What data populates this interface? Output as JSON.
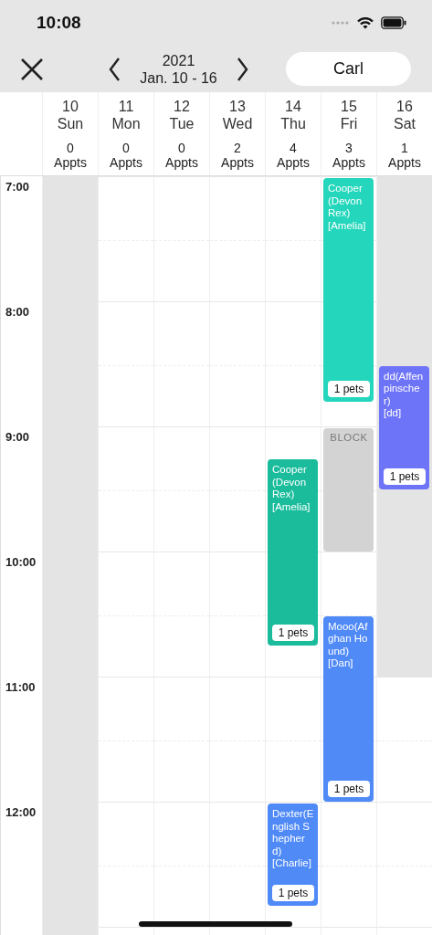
{
  "status_bar": {
    "time": "10:08"
  },
  "toolbar": {
    "year": "2021",
    "range": "Jan. 10 - 16",
    "staff": "Carl"
  },
  "hours": [
    "7:00",
    "8:00",
    "9:00",
    "10:00",
    "11:00",
    "12:00"
  ],
  "days": [
    {
      "date": "10",
      "weekday": "Sun",
      "count": "0",
      "count_label": "Appts",
      "unavailable": true
    },
    {
      "date": "11",
      "weekday": "Mon",
      "count": "0",
      "count_label": "Appts",
      "unavailable": false
    },
    {
      "date": "12",
      "weekday": "Tue",
      "count": "0",
      "count_label": "Appts",
      "unavailable": false
    },
    {
      "date": "13",
      "weekday": "Wed",
      "count": "2",
      "count_label": "Appts",
      "unavailable": false
    },
    {
      "date": "14",
      "weekday": "Thu",
      "count": "4",
      "count_label": "Appts",
      "unavailable": false,
      "events": [
        {
          "kind": "appointment",
          "title": "Cooper(Devon Rex)",
          "owner": "[Amelia]",
          "pets": "1 pets",
          "color": "#1abc9c"
        },
        {
          "kind": "appointment",
          "title": "Dexter(English Shepherd)",
          "owner": "[Charlie]",
          "pets": "1 pets",
          "color": "#4f8af7"
        }
      ]
    },
    {
      "date": "15",
      "weekday": "Fri",
      "count": "3",
      "count_label": "Appts",
      "unavailable": false,
      "events": [
        {
          "kind": "appointment",
          "title": "Cooper(Devon Rex)",
          "owner": "[Amelia]",
          "pets": "1 pets",
          "color": "#24d6bb"
        },
        {
          "kind": "block",
          "title": "BLOCK"
        },
        {
          "kind": "appointment",
          "title": "Mooo(Afghan Hound)",
          "owner": "[Dan]",
          "pets": "1 pets",
          "color": "#4f8af7"
        }
      ]
    },
    {
      "date": "16",
      "weekday": "Sat",
      "count": "1",
      "count_label": "Appts",
      "unavailable": true,
      "events": [
        {
          "kind": "appointment",
          "title": "dd(Affenpinscher)",
          "owner": "[dd]",
          "pets": "1 pets",
          "color": "#6e74f8"
        }
      ]
    }
  ]
}
